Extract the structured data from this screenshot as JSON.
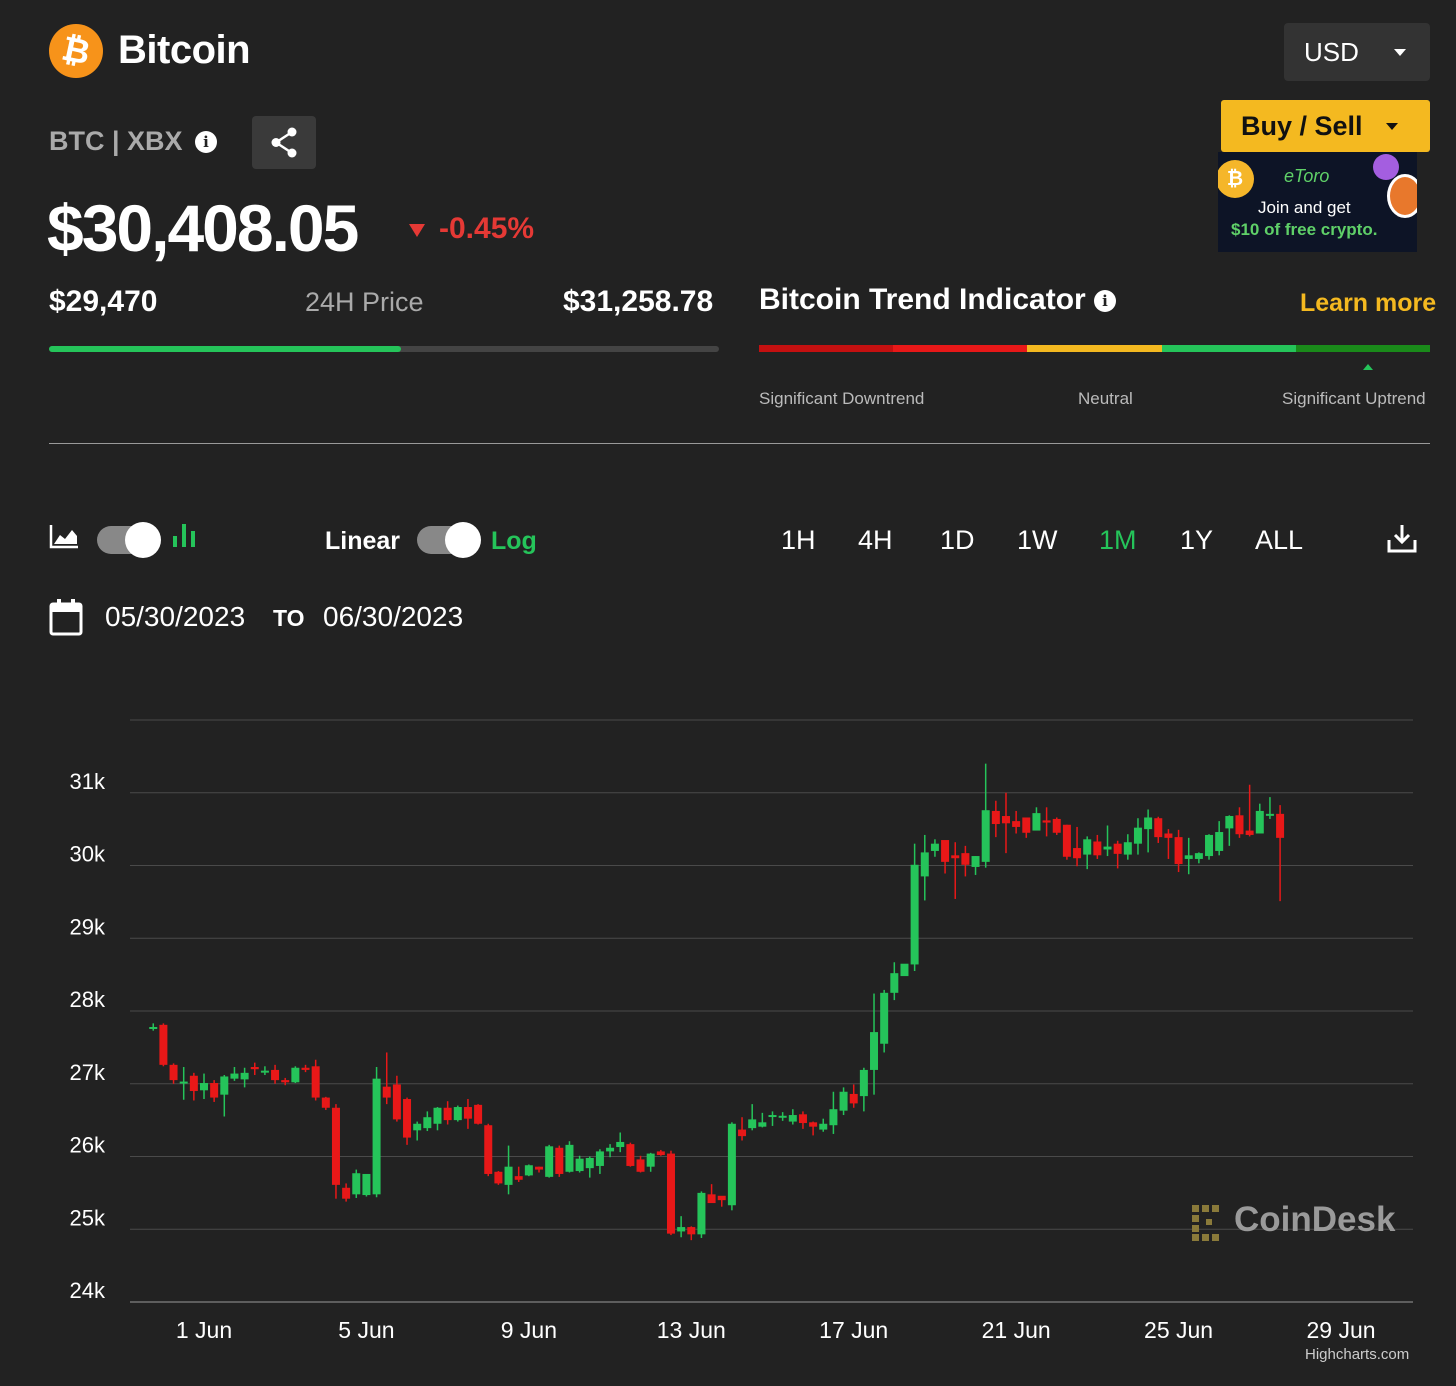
{
  "header": {
    "coin_name": "Bitcoin",
    "coin_symbol_glyph": "₿",
    "ticker": "BTC | XBX",
    "currency": "USD",
    "buy_sell": "Buy / Sell"
  },
  "ad": {
    "brand": "eToro",
    "line1": "Join and get",
    "line2": "$10 of free crypto."
  },
  "price": {
    "current": "$30,408.05",
    "change": "-0.45%",
    "low_24h": "$29,470",
    "range_label": "24H Price",
    "high_24h": "$31,258.78",
    "range_position": 0.525
  },
  "trend": {
    "title": "Bitcoin Trend Indicator",
    "learn_more": "Learn more",
    "labels": [
      "Significant Downtrend",
      "Neutral",
      "Significant Uptrend"
    ],
    "segment_colors": [
      "#c41010",
      "#e81818",
      "#f4b920",
      "#25c45a",
      "#1a8a1a"
    ],
    "active_segment": 4
  },
  "controls": {
    "linear_label": "Linear",
    "log_label": "Log",
    "timeframes": [
      "1H",
      "4H",
      "1D",
      "1W",
      "1M",
      "1Y",
      "ALL"
    ],
    "active_timeframe": "1M",
    "date_from": "05/30/2023",
    "date_to_label": "TO",
    "date_to": "06/30/2023"
  },
  "chart_data": {
    "type": "candlestick",
    "title": "",
    "y_ticks": [
      "31k",
      "30k",
      "29k",
      "28k",
      "27k",
      "26k",
      "25k",
      "24k"
    ],
    "y_tick_values": [
      31000,
      30000,
      29000,
      28000,
      27000,
      26000,
      25000,
      24000
    ],
    "ylim": [
      24000,
      32000
    ],
    "x_ticks": [
      "1 Jun",
      "5 Jun",
      "9 Jun",
      "13 Jun",
      "17 Jun",
      "21 Jun",
      "25 Jun",
      "29 Jun"
    ],
    "x_tick_days": [
      1,
      5,
      9,
      13,
      17,
      21,
      25,
      29
    ],
    "up_color": "#25c45a",
    "down_color": "#e81818",
    "candles": [
      [
        -0.25,
        27780,
        27780,
        27730,
        27830
      ],
      [
        0.0,
        27810,
        27260,
        27240,
        27830
      ],
      [
        0.25,
        27260,
        27050,
        27000,
        27280
      ],
      [
        0.5,
        27010,
        27030,
        26780,
        27230
      ],
      [
        0.75,
        27110,
        26900,
        26770,
        27150
      ],
      [
        1.0,
        26910,
        27010,
        26790,
        27140
      ],
      [
        1.25,
        27010,
        26810,
        26750,
        27050
      ],
      [
        1.5,
        26850,
        27100,
        26550,
        27120
      ],
      [
        1.75,
        27070,
        27140,
        27040,
        27230
      ],
      [
        2.0,
        27060,
        27150,
        26950,
        27220
      ],
      [
        2.25,
        27230,
        27200,
        27120,
        27290
      ],
      [
        2.5,
        27160,
        27180,
        27120,
        27240
      ],
      [
        2.75,
        27190,
        27050,
        27000,
        27260
      ],
      [
        3.0,
        27050,
        27020,
        26980,
        27080
      ],
      [
        3.25,
        27020,
        27220,
        27010,
        27240
      ],
      [
        3.5,
        27220,
        27190,
        27160,
        27260
      ],
      [
        3.75,
        27240,
        26810,
        26770,
        27330
      ],
      [
        4.0,
        26810,
        26670,
        26640,
        26820
      ],
      [
        4.25,
        26670,
        25610,
        25420,
        26720
      ],
      [
        4.5,
        25570,
        25420,
        25380,
        25630
      ],
      [
        4.75,
        25480,
        25770,
        25430,
        25820
      ],
      [
        5.0,
        25470,
        25760,
        25450,
        25650
      ],
      [
        5.25,
        25480,
        27070,
        25440,
        27230
      ],
      [
        5.5,
        26960,
        26810,
        26720,
        27430
      ],
      [
        5.75,
        26990,
        26510,
        26480,
        27110
      ],
      [
        6.0,
        26790,
        26260,
        26160,
        26810
      ],
      [
        6.25,
        26360,
        26450,
        26220,
        26480
      ],
      [
        6.5,
        26390,
        26540,
        26350,
        26620
      ],
      [
        6.75,
        26450,
        26670,
        26360,
        26680
      ],
      [
        7.0,
        26670,
        26500,
        26440,
        26760
      ],
      [
        7.25,
        26500,
        26680,
        26480,
        26700
      ],
      [
        7.5,
        26680,
        26520,
        26380,
        26790
      ],
      [
        7.75,
        26710,
        26450,
        26440,
        26720
      ],
      [
        8.0,
        26430,
        25760,
        25730,
        26450
      ],
      [
        8.25,
        25790,
        25630,
        25610,
        25800
      ],
      [
        8.5,
        25610,
        25860,
        25480,
        26150
      ],
      [
        8.75,
        25730,
        25680,
        25650,
        25860
      ],
      [
        9.0,
        25740,
        25880,
        25730,
        25890
      ],
      [
        9.25,
        25860,
        25820,
        25780,
        25860
      ],
      [
        9.5,
        25720,
        26140,
        25710,
        26160
      ],
      [
        9.75,
        26120,
        25760,
        25720,
        26150
      ],
      [
        10.0,
        25790,
        26160,
        25780,
        26210
      ],
      [
        10.25,
        25800,
        25970,
        25780,
        26010
      ],
      [
        10.5,
        25840,
        25980,
        25710,
        26000
      ],
      [
        10.75,
        25870,
        26070,
        25760,
        26100
      ],
      [
        11.0,
        26070,
        26120,
        25990,
        26170
      ],
      [
        11.25,
        26130,
        26200,
        26060,
        26330
      ],
      [
        11.5,
        26170,
        25870,
        25860,
        26190
      ],
      [
        11.75,
        25960,
        25790,
        25780,
        26010
      ],
      [
        12.0,
        25860,
        26040,
        25790,
        26050
      ],
      [
        12.25,
        26070,
        26020,
        26010,
        26090
      ],
      [
        12.5,
        26040,
        24940,
        24920,
        26080
      ],
      [
        12.75,
        24970,
        25030,
        24890,
        25180
      ],
      [
        13.0,
        25030,
        24930,
        24850,
        25040
      ],
      [
        13.25,
        24930,
        25500,
        24880,
        25520
      ],
      [
        13.5,
        25480,
        25360,
        25390,
        25620
      ],
      [
        13.75,
        25460,
        25400,
        25310,
        25430
      ],
      [
        14.0,
        25330,
        26450,
        25260,
        26470
      ],
      [
        14.25,
        26370,
        26280,
        26220,
        26540
      ],
      [
        14.5,
        26390,
        26510,
        26360,
        26720
      ],
      [
        14.75,
        26410,
        26470,
        26400,
        26600
      ],
      [
        15.0,
        26550,
        26570,
        26420,
        26620
      ],
      [
        15.25,
        26540,
        26560,
        26490,
        26610
      ],
      [
        15.5,
        26480,
        26570,
        26440,
        26650
      ],
      [
        15.75,
        26580,
        26460,
        26380,
        26620
      ],
      [
        16.0,
        26470,
        26410,
        26290,
        26480
      ],
      [
        16.25,
        26370,
        26450,
        26340,
        26520
      ],
      [
        16.5,
        26430,
        26650,
        26310,
        26890
      ],
      [
        16.75,
        26630,
        26890,
        26570,
        26950
      ],
      [
        17.0,
        26860,
        26730,
        26670,
        26990
      ],
      [
        17.25,
        26830,
        27190,
        26620,
        27220
      ],
      [
        17.5,
        27190,
        27710,
        26850,
        28240
      ],
      [
        17.75,
        27550,
        28250,
        27430,
        28290
      ],
      [
        18.0,
        28250,
        28520,
        28150,
        28670
      ],
      [
        18.25,
        28480,
        28650,
        28490,
        28590
      ],
      [
        18.5,
        28640,
        30010,
        28550,
        30300
      ],
      [
        18.75,
        29850,
        30180,
        29520,
        30420
      ],
      [
        19.0,
        30200,
        30300,
        30120,
        30360
      ],
      [
        19.25,
        30350,
        30050,
        29890,
        30280
      ],
      [
        19.5,
        30140,
        30100,
        29540,
        30320
      ],
      [
        19.75,
        30170,
        30010,
        29850,
        30270
      ],
      [
        20.0,
        29980,
        30130,
        29870,
        30130
      ],
      [
        20.25,
        30050,
        30760,
        29970,
        31400
      ],
      [
        20.5,
        30750,
        30570,
        30390,
        30890
      ],
      [
        20.75,
        30680,
        30580,
        30170,
        31000
      ],
      [
        21.0,
        30610,
        30530,
        30440,
        30750
      ],
      [
        21.25,
        30660,
        30450,
        30380,
        30600
      ],
      [
        21.5,
        30480,
        30720,
        30490,
        30800
      ],
      [
        21.75,
        30620,
        30590,
        30400,
        30800
      ],
      [
        22.0,
        30640,
        30450,
        30420,
        30660
      ],
      [
        22.25,
        30560,
        30120,
        30080,
        30560
      ],
      [
        22.5,
        30240,
        30100,
        29990,
        30530
      ],
      [
        22.75,
        30150,
        30360,
        29950,
        30400
      ],
      [
        23.0,
        30330,
        30140,
        30090,
        30420
      ],
      [
        23.25,
        30220,
        30260,
        30130,
        30550
      ],
      [
        23.5,
        30300,
        30160,
        29960,
        30340
      ],
      [
        23.75,
        30150,
        30320,
        30080,
        30430
      ],
      [
        24.0,
        30300,
        30520,
        30150,
        30650
      ],
      [
        24.25,
        30500,
        30660,
        30180,
        30770
      ],
      [
        24.5,
        30650,
        30390,
        30310,
        30670
      ],
      [
        24.75,
        30440,
        30380,
        30090,
        30500
      ],
      [
        25.0,
        30390,
        30020,
        29910,
        30490
      ],
      [
        25.25,
        30090,
        30140,
        29880,
        30380
      ],
      [
        25.5,
        30090,
        30170,
        30030,
        30180
      ],
      [
        25.75,
        30130,
        30420,
        30080,
        30430
      ],
      [
        26.0,
        30200,
        30460,
        30140,
        30610
      ],
      [
        26.25,
        30510,
        30680,
        30270,
        30690
      ],
      [
        26.5,
        30690,
        30430,
        30380,
        30800
      ],
      [
        26.75,
        30480,
        30420,
        30400,
        31110
      ],
      [
        27.0,
        30440,
        30750,
        30440,
        30850
      ],
      [
        27.25,
        30710,
        30710,
        30640,
        30940
      ],
      [
        27.5,
        30710,
        30380,
        29510,
        30830
      ]
    ]
  },
  "watermark": "CoinDesk",
  "credit": "Highcharts.com"
}
